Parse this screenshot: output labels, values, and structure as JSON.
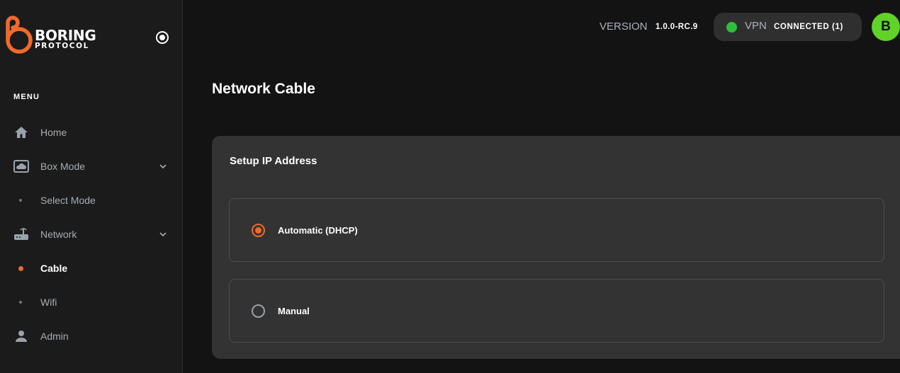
{
  "brand": {
    "name_line1": "BORING",
    "name_line2": "PROTOCOL",
    "accent_color": "#f26a2a"
  },
  "sidebar": {
    "menu_heading": "MENU",
    "items": [
      {
        "label": "Home",
        "icon": "home-icon"
      },
      {
        "label": "Box Mode",
        "icon": "cloud-box-icon",
        "expandable": true
      },
      {
        "label": "Select Mode",
        "sub": true
      },
      {
        "label": "Network",
        "icon": "router-icon",
        "expandable": true
      },
      {
        "label": "Cable",
        "sub": true,
        "active": true
      },
      {
        "label": "Wifi",
        "sub": true
      },
      {
        "label": "Admin",
        "icon": "user-icon"
      }
    ]
  },
  "topbar": {
    "version_label": "VERSION",
    "version_value": "1.0.0-RC.9",
    "vpn_label": "VPN",
    "vpn_status": "CONNECTED (1)",
    "vpn_status_color": "#2fbf3a",
    "avatar_initial": "B",
    "avatar_color": "#5fd327"
  },
  "main": {
    "page_title": "Network Cable",
    "card": {
      "title": "Setup IP Address",
      "options": [
        {
          "label": "Automatic (DHCP)",
          "selected": true
        },
        {
          "label": "Manual",
          "selected": false
        }
      ]
    }
  }
}
